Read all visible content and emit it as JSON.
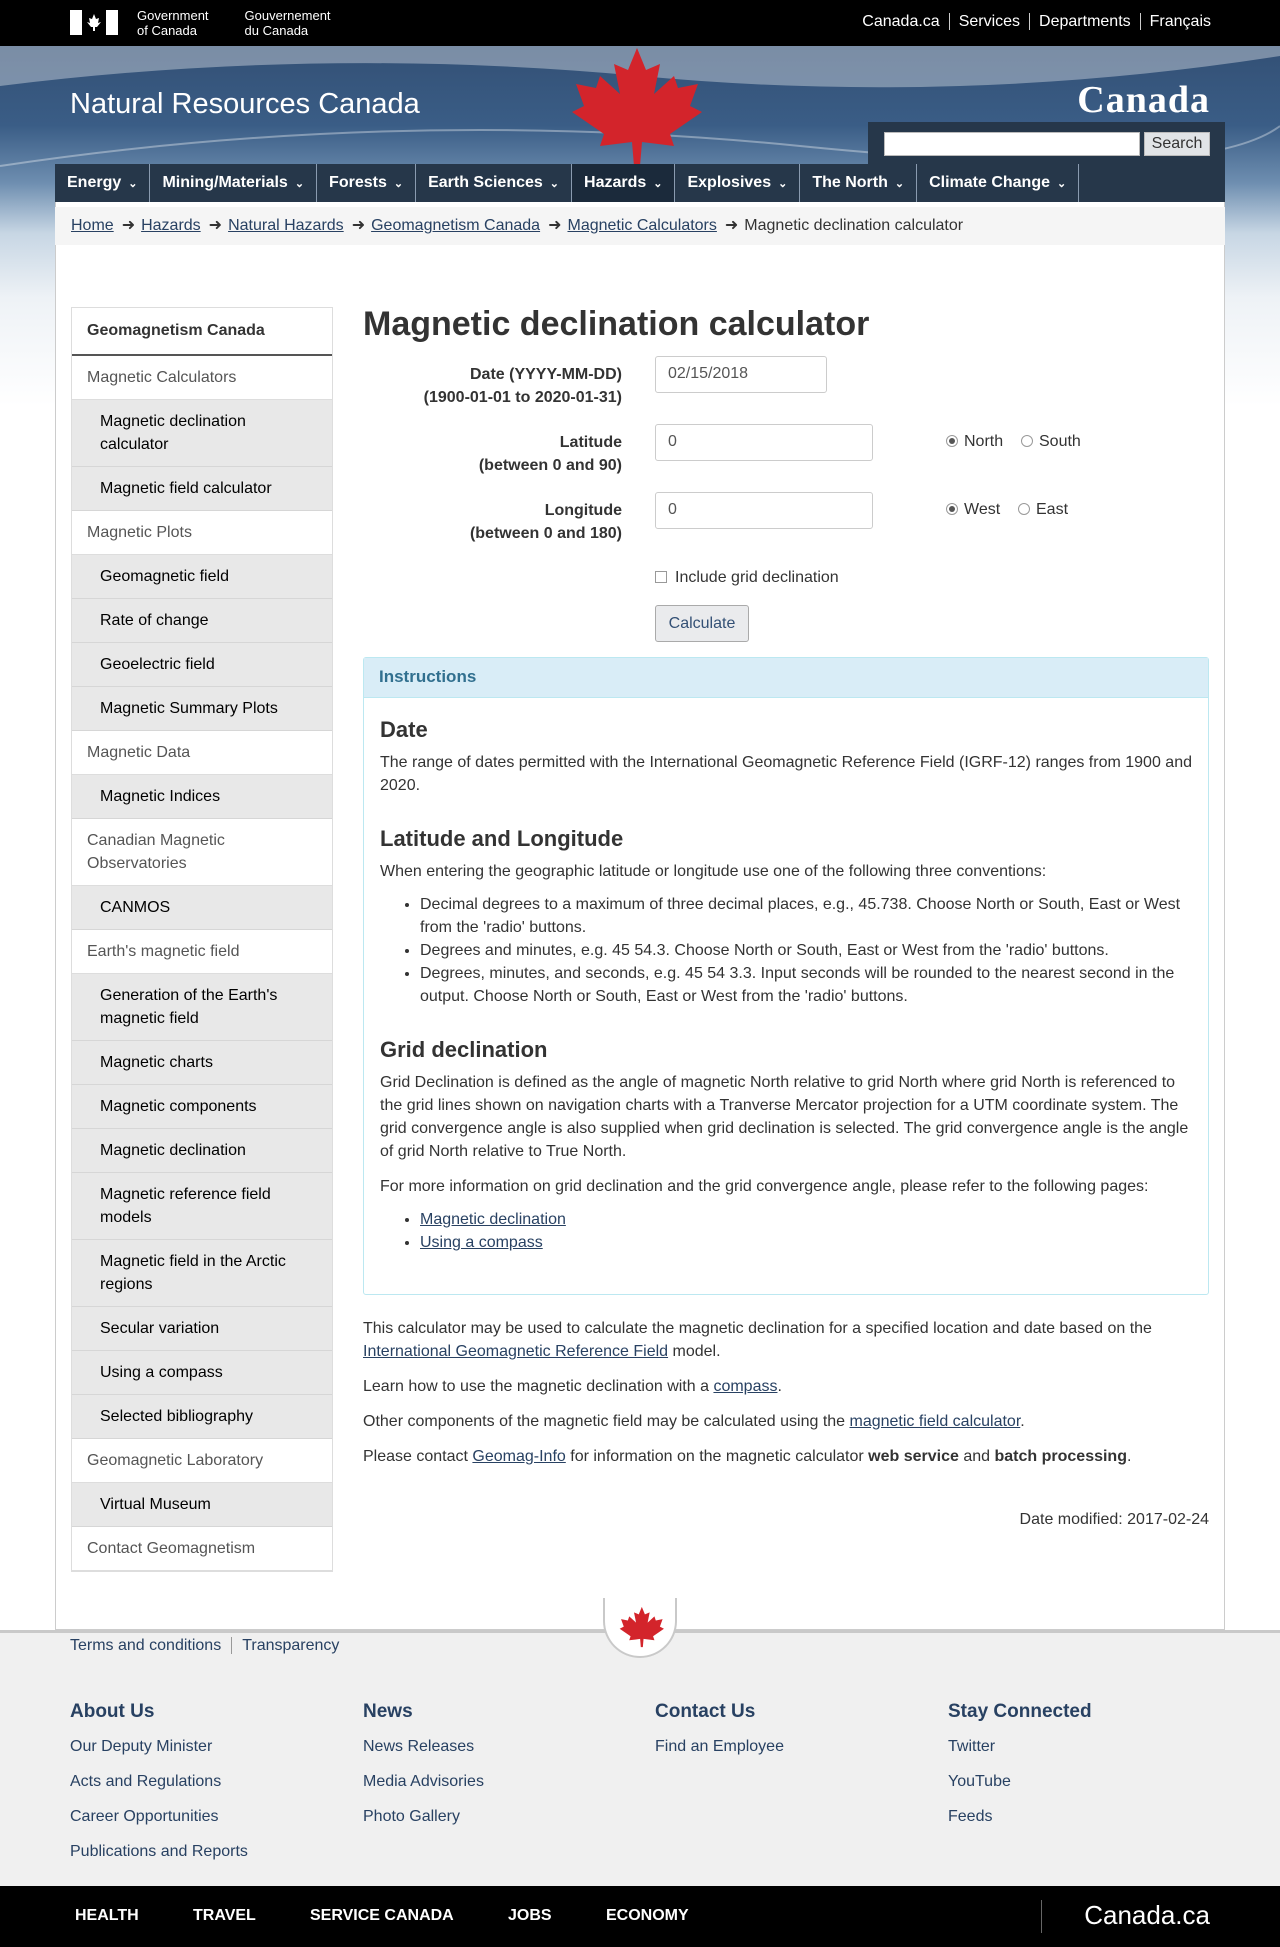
{
  "gov": {
    "sig_en": [
      "Government",
      "of Canada"
    ],
    "sig_fr": [
      "Gouvernement",
      "du Canada"
    ],
    "links": [
      "Canada.ca",
      "Services",
      "Departments",
      "Français"
    ]
  },
  "site": {
    "title": "Natural Resources Canada",
    "wordmark": "Canada",
    "search_button": "Search",
    "search_placeholder": ""
  },
  "menu": [
    {
      "label": "Energy"
    },
    {
      "label": "Mining/Materials"
    },
    {
      "label": "Forests"
    },
    {
      "label": "Earth Sciences"
    },
    {
      "label": "Hazards",
      "active": true
    },
    {
      "label": "Explosives"
    },
    {
      "label": "The North"
    },
    {
      "label": "Climate Change"
    }
  ],
  "breadcrumb": [
    "Home",
    "Hazards",
    "Natural Hazards",
    "Geomagnetism Canada",
    "Magnetic Calculators",
    "Magnetic declination calculator"
  ],
  "leftnav": {
    "heading": "Geomagnetism Canada",
    "items": [
      {
        "type": "sec",
        "label": "Magnetic Calculators"
      },
      {
        "type": "sub",
        "label": "Magnetic declination calculator"
      },
      {
        "type": "sub",
        "label": "Magnetic field calculator"
      },
      {
        "type": "sec",
        "label": "Magnetic Plots"
      },
      {
        "type": "sub",
        "label": "Geomagnetic field"
      },
      {
        "type": "sub",
        "label": "Rate of change"
      },
      {
        "type": "sub",
        "label": "Geoelectric field"
      },
      {
        "type": "sub",
        "label": "Magnetic Summary Plots"
      },
      {
        "type": "sec",
        "label": "Magnetic Data"
      },
      {
        "type": "sub",
        "label": "Magnetic Indices"
      },
      {
        "type": "sec",
        "label": "Canadian Magnetic Observatories"
      },
      {
        "type": "sub",
        "label": "CANMOS"
      },
      {
        "type": "sec",
        "label": "Earth's magnetic field"
      },
      {
        "type": "sub",
        "label": "Generation of the Earth's magnetic field"
      },
      {
        "type": "sub",
        "label": "Magnetic charts"
      },
      {
        "type": "sub",
        "label": "Magnetic components"
      },
      {
        "type": "sub",
        "label": "Magnetic declination"
      },
      {
        "type": "sub",
        "label": "Magnetic reference field models"
      },
      {
        "type": "sub",
        "label": "Magnetic field in the Arctic regions"
      },
      {
        "type": "sub",
        "label": "Secular variation"
      },
      {
        "type": "sub",
        "label": "Using a compass"
      },
      {
        "type": "sub",
        "label": "Selected bibliography"
      },
      {
        "type": "sec",
        "label": "Geomagnetic Laboratory"
      },
      {
        "type": "sub",
        "label": "Virtual Museum"
      },
      {
        "type": "sec",
        "label": "Contact Geomagnetism"
      }
    ]
  },
  "page": {
    "title": "Magnetic declination calculator",
    "form": {
      "date_label": "Date (YYYY-MM-DD)",
      "date_range": "(1900-01-01 to 2020-01-31)",
      "date_value": "02/15/2018",
      "lat_label": "Latitude",
      "lat_range": "(between 0 and 90)",
      "lat_value": "0",
      "lat_opt1": "North",
      "lat_opt2": "South",
      "lon_label": "Longitude",
      "lon_range": "(between 0 and 180)",
      "lon_value": "0",
      "lon_opt1": "West",
      "lon_opt2": "East",
      "grid_label": "Include grid declination",
      "calc_button": "Calculate"
    },
    "instructions": {
      "heading": "Instructions",
      "date_h": "Date",
      "date_p": "The range of dates permitted with the International Geomagnetic Reference Field (IGRF-12) ranges from 1900 and 2020.",
      "latlon_h": "Latitude and Longitude",
      "latlon_p": "When entering the geographic latitude or longitude use one of the following three conventions:",
      "latlon_list": [
        "Decimal degrees to a maximum of three decimal places, e.g., 45.738. Choose North or South, East or West from the 'radio' buttons.",
        "Degrees and minutes, e.g. 45 54.3. Choose North or South, East or West from the 'radio' buttons.",
        "Degrees, minutes, and seconds, e.g. 45 54 3.3. Input seconds will be rounded to the nearest second in the output. Choose North or South, East or West from the 'radio' buttons."
      ],
      "grid_h": "Grid declination",
      "grid_p1": "Grid Declination is defined as the angle of magnetic North relative to grid North where grid North is referenced to the grid lines shown on navigation charts with a Tranverse Mercator projection for a UTM coordinate system. The grid convergence angle is also supplied when grid declination is selected. The grid convergence angle is the angle of grid North relative to True North.",
      "grid_p2": "For more information on grid declination and the grid convergence angle, please refer to the following pages:",
      "grid_links": [
        "Magnetic declination",
        "Using a compass"
      ]
    },
    "after": {
      "p1_a": "This calculator may be used to calculate the magnetic declination for a specified location and date based on the ",
      "p1_link": "International Geomagnetic Reference Field",
      "p1_b": " model.",
      "p2_a": "Learn how to use the magnetic declination with a ",
      "p2_link": "compass",
      "p2_b": ".",
      "p3_a": "Other components of the magnetic field may be calculated using the ",
      "p3_link": "magnetic field calculator",
      "p3_b": ".",
      "p4_a": "Please contact ",
      "p4_link": "Geomag-Info",
      "p4_b": " for information on the magnetic calculator ",
      "p4_bold1": "web service",
      "p4_c": " and ",
      "p4_bold2": "batch processing",
      "p4_d": "."
    },
    "modified": "Date modified: 2017-02-24"
  },
  "footer": {
    "top_links": [
      "Terms and conditions",
      "Transparency"
    ],
    "columns": [
      {
        "heading": "About Us",
        "links": [
          "Our Deputy Minister",
          "Acts and Regulations",
          "Career Opportunities",
          "Publications and Reports"
        ]
      },
      {
        "heading": "News",
        "links": [
          "News Releases",
          "Media Advisories",
          "Photo Gallery"
        ]
      },
      {
        "heading": "Contact Us",
        "links": [
          "Find an Employee"
        ]
      },
      {
        "heading": "Stay Connected",
        "links": [
          "Twitter",
          "YouTube",
          "Feeds"
        ]
      }
    ],
    "bottom": [
      "HEALTH",
      "TRAVEL",
      "SERVICE CANADA",
      "JOBS",
      "ECONOMY"
    ],
    "canada": "Canada.ca"
  },
  "colors": {
    "brand_dark": "#26374a",
    "link": "#284162",
    "flag_red": "#d3242b"
  }
}
